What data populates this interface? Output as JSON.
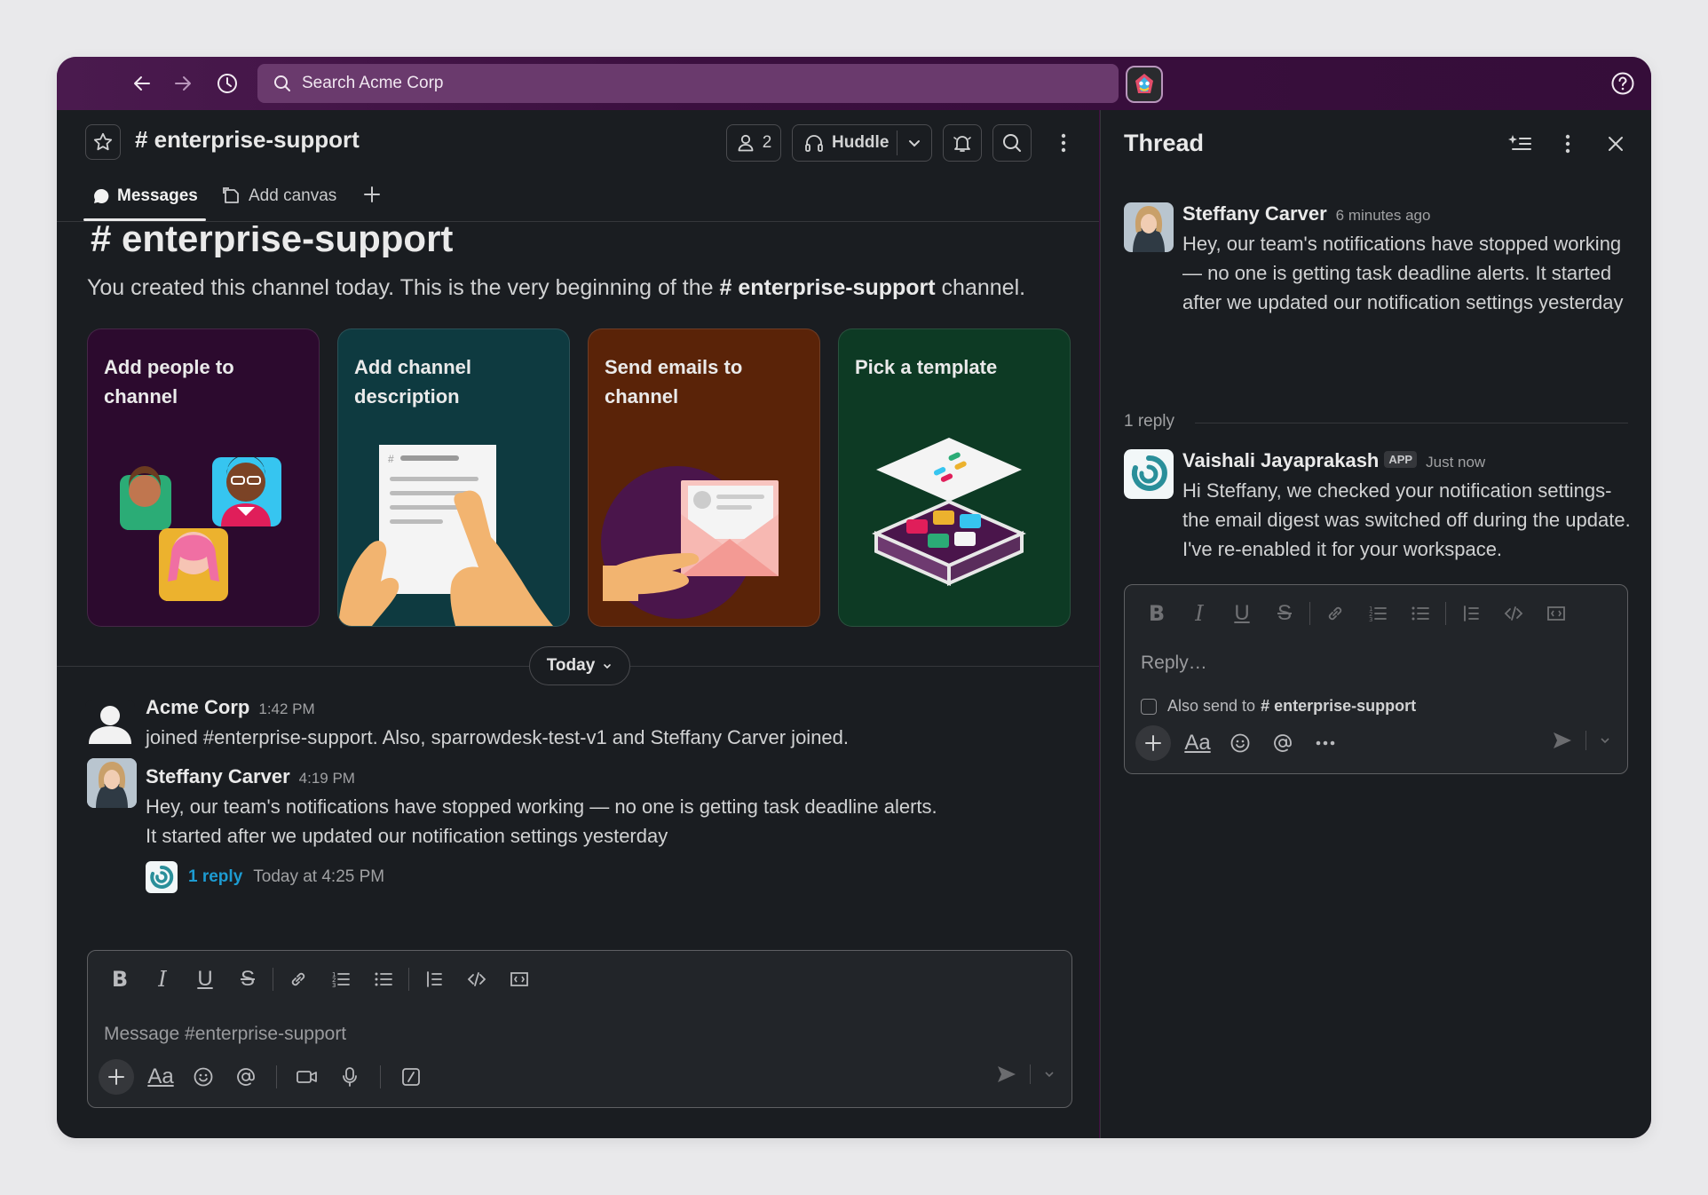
{
  "topbar": {
    "search_placeholder": "Search Acme Corp"
  },
  "channel": {
    "name": "# enterprise-support",
    "member_count": "2",
    "huddle_label": "Huddle"
  },
  "tabs": [
    {
      "label": "Messages"
    },
    {
      "label": "Add canvas"
    }
  ],
  "intro": {
    "title": "# enterprise-support",
    "text_before": "You created this channel today. This is the very beginning of the ",
    "text_channel": "# enterprise-support",
    "text_after": " channel."
  },
  "cards": [
    {
      "label": "Add people to channel",
      "bg": "#2c0a2e"
    },
    {
      "label": "Add channel description",
      "bg": "#0e3a40"
    },
    {
      "label": "Send emails to channel",
      "bg": "#5a2308"
    },
    {
      "label": "Pick a template",
      "bg": "#0d3a24"
    }
  ],
  "divider_label": "Today",
  "messages": [
    {
      "author": "Acme Corp",
      "time": "1:42 PM",
      "text": "joined #enterprise-support. Also, sparrowdesk-test-v1 and Steffany Carver joined."
    },
    {
      "author": "Steffany Carver",
      "time": "4:19 PM",
      "lines": [
        "Hey, our team's notifications have stopped working — no one is getting task deadline alerts.",
        "It started after we updated our notification settings yesterday"
      ],
      "reply_count": "1 reply",
      "reply_meta": "Today at 4:25 PM"
    }
  ],
  "composer": {
    "placeholder": "Message #enterprise-support",
    "format_text": "Aa"
  },
  "thread": {
    "title": "Thread",
    "parent": {
      "author": "Steffany Carver",
      "time": "6 minutes ago",
      "text": "Hey, our team's notifications have stopped working — no one is getting task deadline alerts. It started after we updated our notification settings yesterday"
    },
    "reply_count": "1 reply",
    "reply": {
      "author": "Vaishali Jayaprakash",
      "badge": "APP",
      "time": "Just now",
      "text": "Hi Steffany, we checked your notification settings- the email digest was switched off during the update. I've re-enabled it for your workspace."
    },
    "composer": {
      "placeholder": "Reply…",
      "also_send_label": "Also send to",
      "also_send_channel": "# enterprise-support",
      "format_text": "Aa"
    }
  },
  "colors": {
    "sidebar_purple": "#3f0e40",
    "link_blue": "#1d9bd1",
    "background": "#1a1d21"
  }
}
